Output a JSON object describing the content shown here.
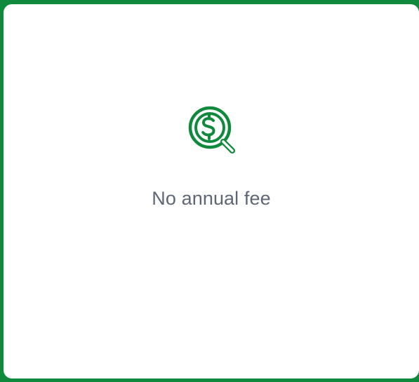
{
  "card": {
    "feature_label": "No annual fee",
    "icon_name": "magnifier-dollar-icon"
  },
  "colors": {
    "accent": "#0f8a3c",
    "text": "#5f6675",
    "background": "#ffffff"
  }
}
